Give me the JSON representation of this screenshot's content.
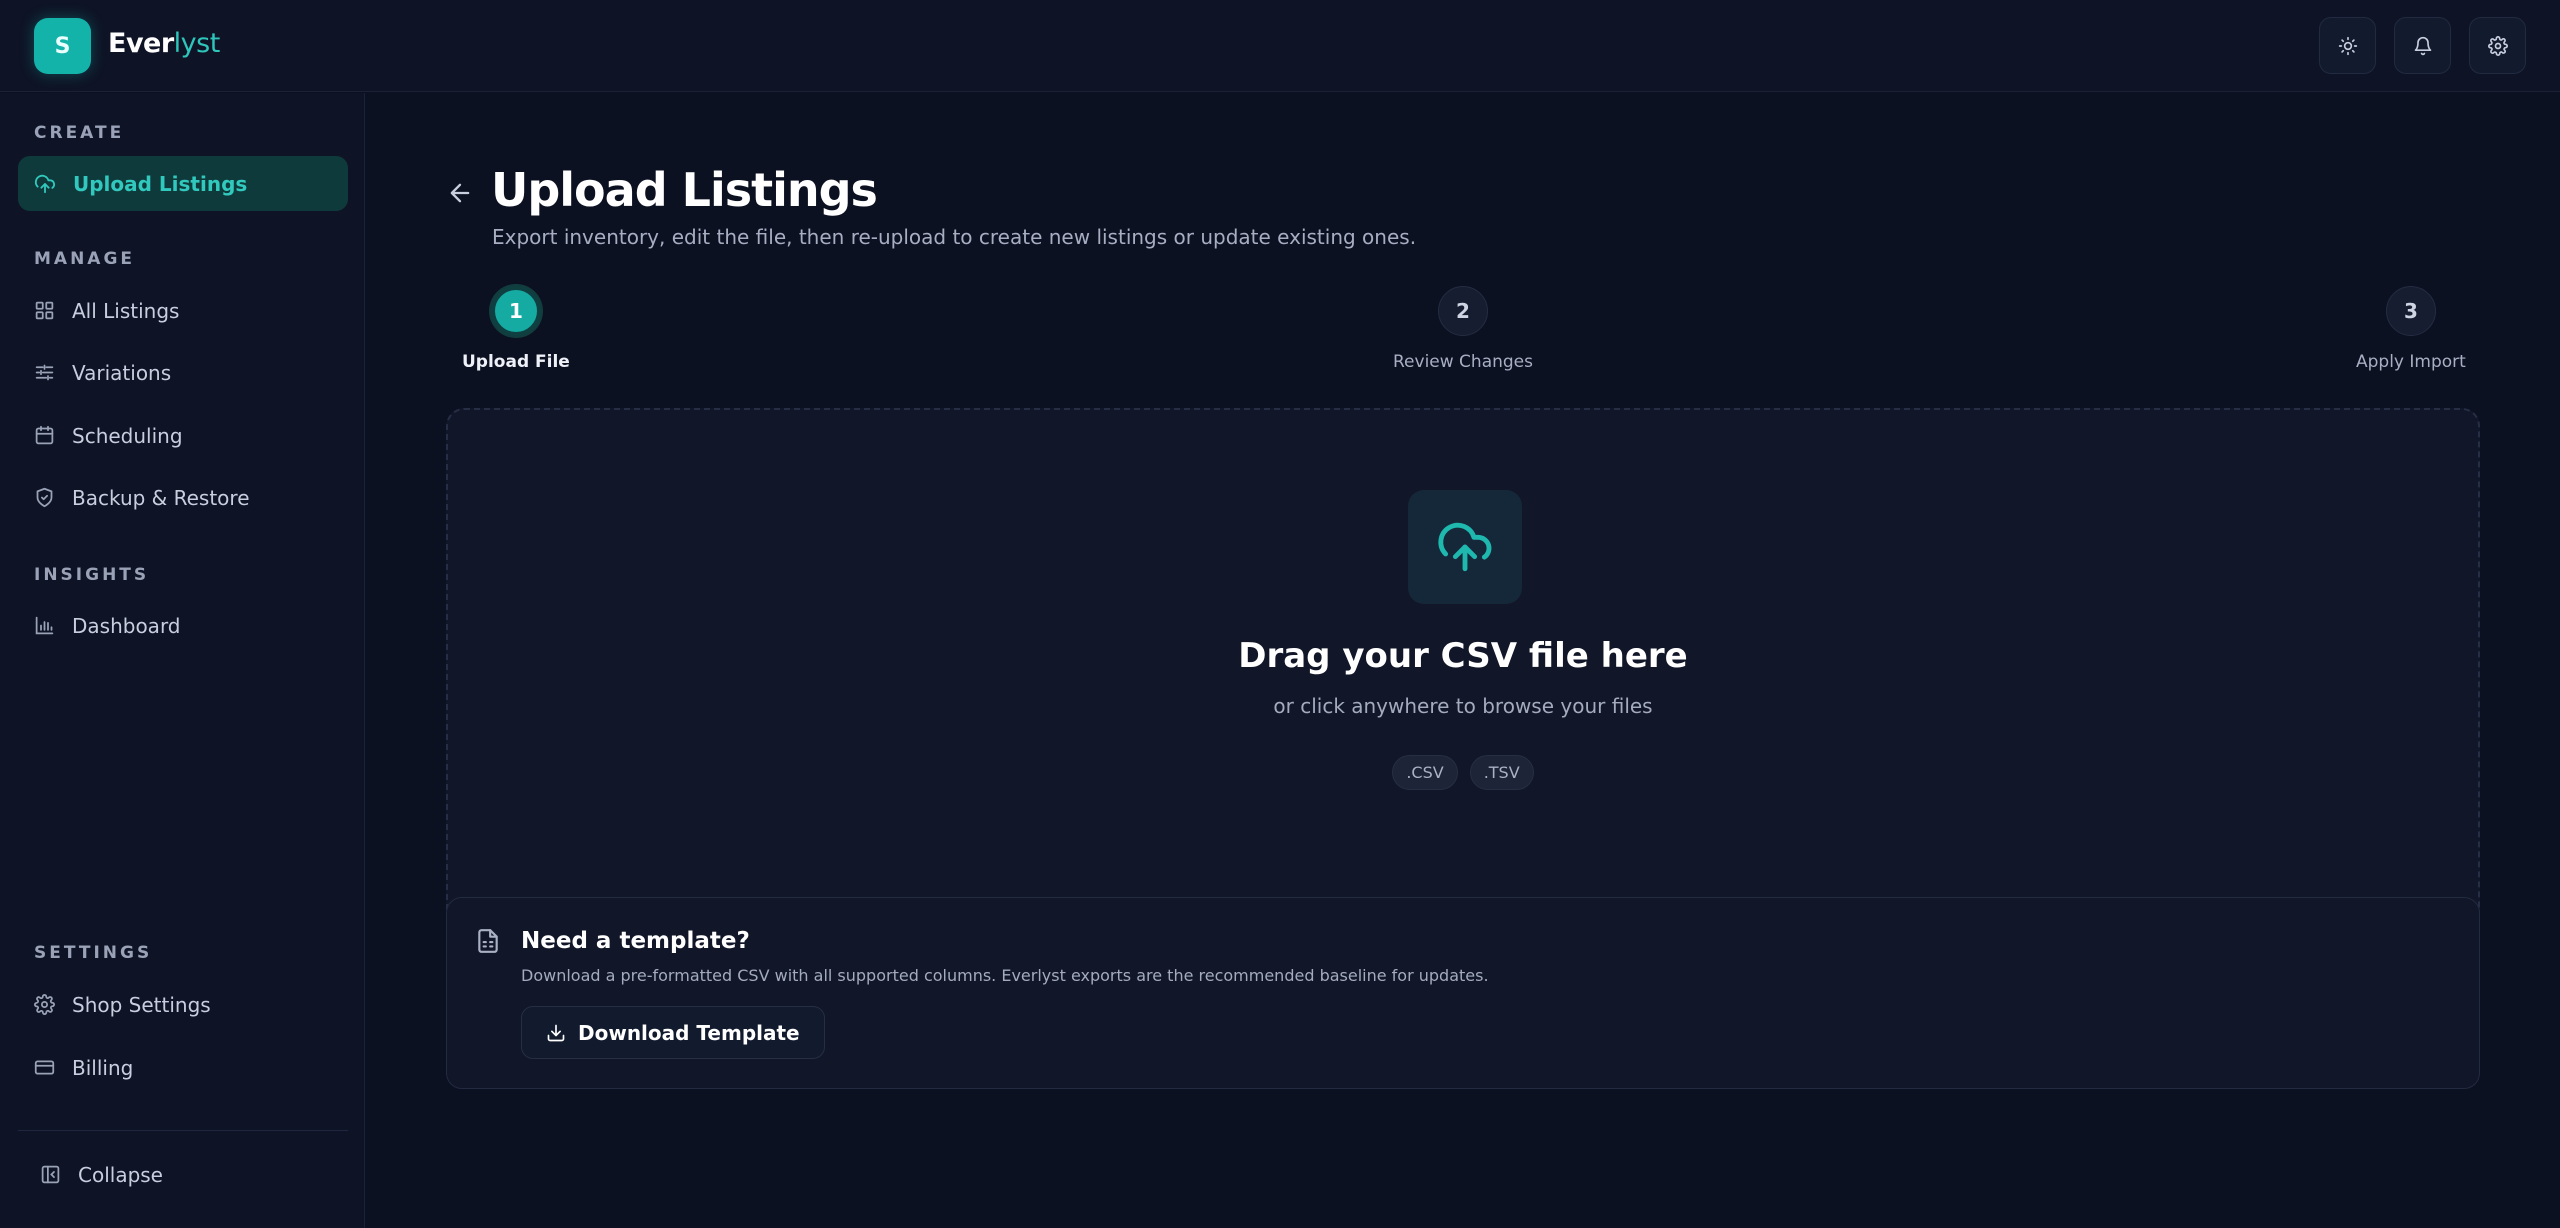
{
  "brand": {
    "initial": "S",
    "name_part1": "Ever",
    "name_part2": "lyst"
  },
  "topbar": {
    "theme_icon": "sun-icon",
    "notifications_icon": "bell-icon",
    "settings_icon": "gear-icon"
  },
  "sidebar": {
    "sections": {
      "create": "CREATE",
      "manage": "MANAGE",
      "insights": "INSIGHTS",
      "settings": "SETTINGS"
    },
    "items": {
      "upload": "Upload Listings",
      "all": "All Listings",
      "variations": "Variations",
      "scheduling": "Scheduling",
      "backup": "Backup & Restore",
      "dashboard": "Dashboard",
      "shop_settings": "Shop Settings",
      "billing": "Billing"
    },
    "collapse": "Collapse"
  },
  "page": {
    "title": "Upload Listings",
    "subtitle": "Export inventory, edit the file, then re-upload to create new listings or update existing ones."
  },
  "steps": [
    {
      "number": "1",
      "label": "Upload File",
      "active": true
    },
    {
      "number": "2",
      "label": "Review Changes",
      "active": false
    },
    {
      "number": "3",
      "label": "Apply Import",
      "active": false
    }
  ],
  "dropzone": {
    "title": "Drag your CSV file here",
    "subtitle": "or click anywhere to browse your files",
    "formats": [
      ".CSV",
      ".TSV"
    ]
  },
  "template": {
    "title": "Need a template?",
    "description": "Download a pre-formatted CSV with all supported columns. Everlyst exports are the recommended baseline for updates.",
    "button": "Download Template"
  },
  "colors": {
    "accent": "#14b3aa",
    "background": "#0c1122",
    "panel": "#111628"
  }
}
